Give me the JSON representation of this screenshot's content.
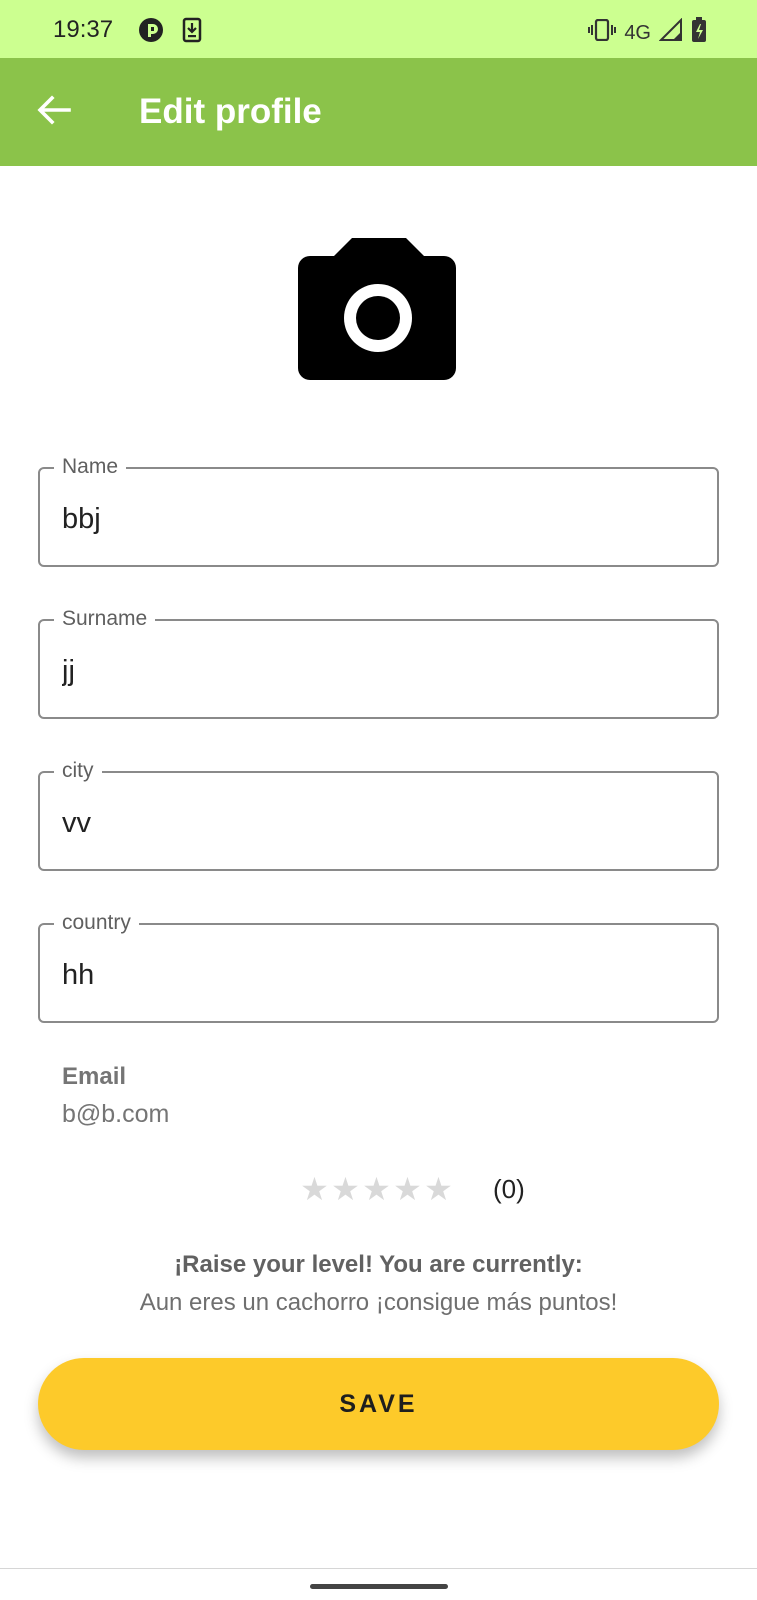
{
  "status_bar": {
    "time": "19:37",
    "left_icons": [
      "app-notification-icon",
      "download-icon"
    ],
    "network": "4G",
    "right_icons": [
      "vibrate-icon",
      "signal-icon",
      "battery-charging-icon"
    ]
  },
  "app_bar": {
    "title": "Edit profile",
    "back_icon": "arrow-left-icon",
    "background": "#8bc34a"
  },
  "avatar": {
    "icon": "camera-icon"
  },
  "form": {
    "name": {
      "label": "Name",
      "value": "bbj"
    },
    "surname": {
      "label": "Surname",
      "value": "jj"
    },
    "city": {
      "label": "city",
      "value": "vv"
    },
    "country": {
      "label": "country",
      "value": "hh"
    }
  },
  "email": {
    "label": "Email",
    "value": "b@b.com"
  },
  "rating": {
    "stars_total": 5,
    "stars_filled": 0,
    "count_text": "(0)"
  },
  "level": {
    "title": "¡Raise your level! You are currently:",
    "text": "Aun eres un cachorro ¡consigue más puntos!"
  },
  "save_label": "SAVE",
  "colors": {
    "status_bar": "#ccff90",
    "accent_button": "#fdca2a"
  }
}
